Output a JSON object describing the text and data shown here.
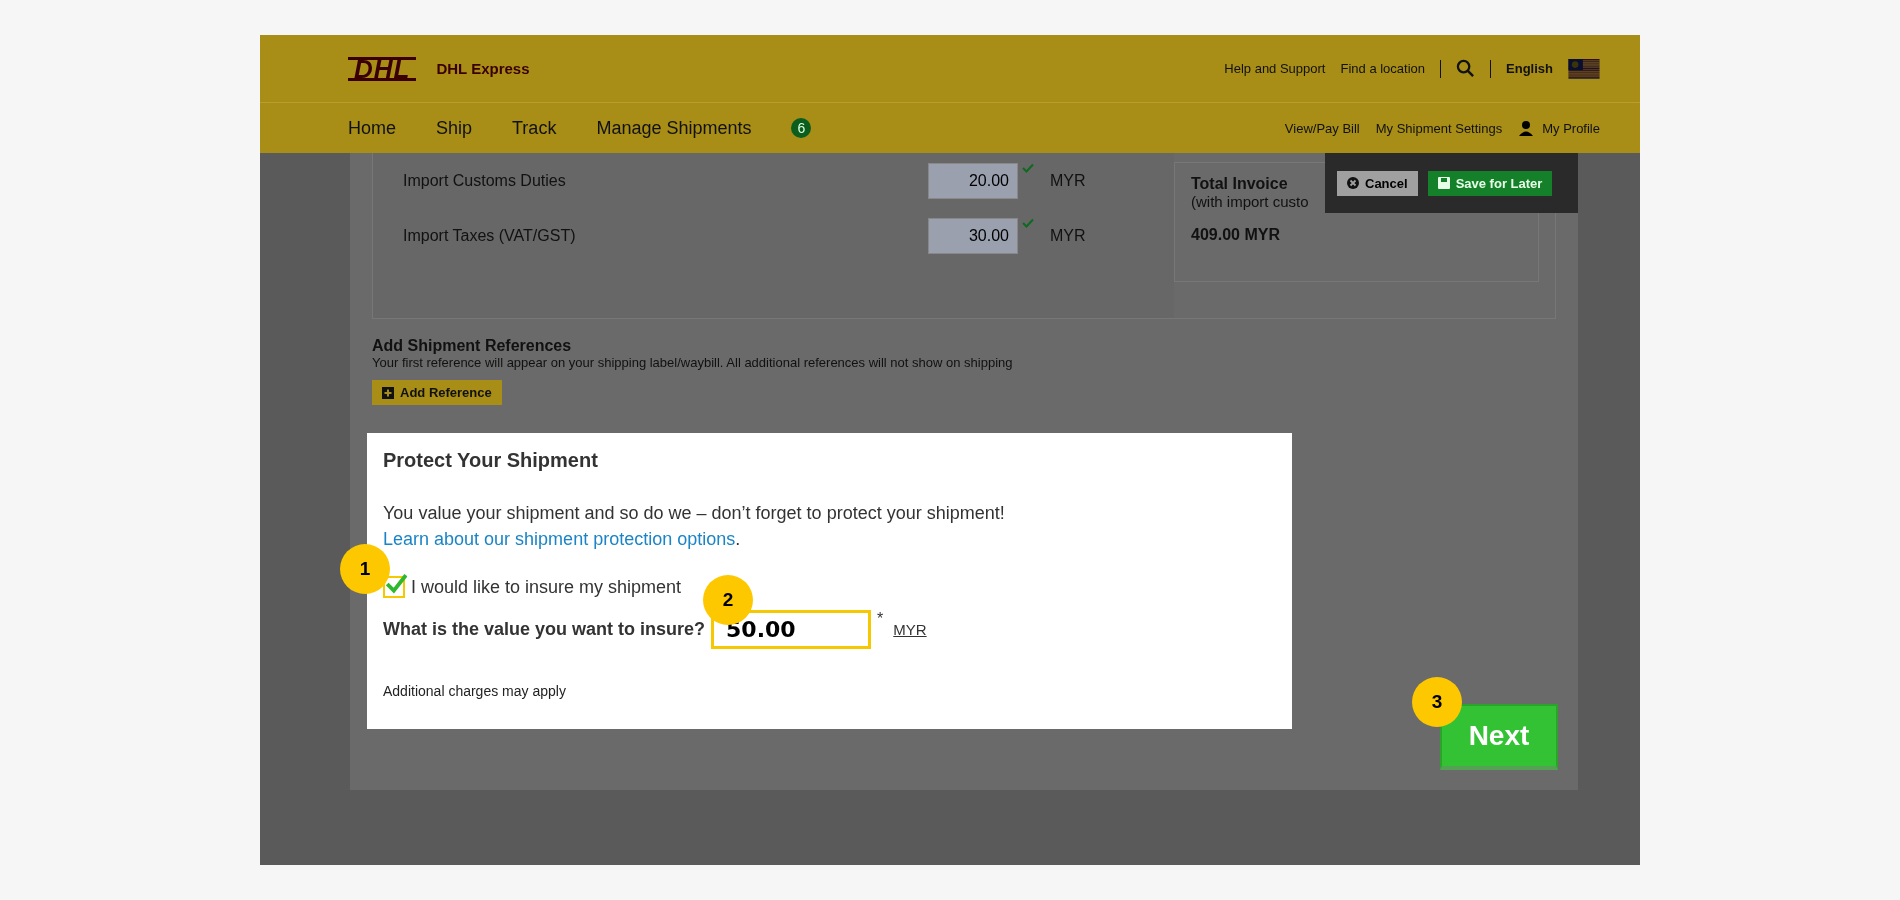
{
  "header": {
    "logo_text": "DHL",
    "brand": "DHL Express",
    "links": [
      "Help and Support",
      "Find a location"
    ],
    "language": "English"
  },
  "nav": {
    "items": [
      {
        "label": "Home"
      },
      {
        "label": "Ship"
      },
      {
        "label": "Track"
      },
      {
        "label": "Manage Shipments",
        "badge": "6"
      }
    ],
    "right_links": [
      "View/Pay Bill",
      "My Shipment Settings"
    ],
    "profile": "My Profile"
  },
  "toolbar": {
    "cancel": "Cancel",
    "save": "Save for Later"
  },
  "charges": [
    {
      "label": "Import Customs Duties",
      "value": "20.00",
      "currency": "MYR"
    },
    {
      "label": "Import Taxes (VAT/GST)",
      "value": "30.00",
      "currency": "MYR"
    }
  ],
  "invoice": {
    "title": "Total Invoice",
    "subtitle": "(with import custo",
    "total": "409.00 MYR"
  },
  "references": {
    "title": "Add Shipment References",
    "description": "Your first reference will appear on your shipping label/waybill. All additional references will not show on shipping",
    "button": "Add Reference"
  },
  "modal": {
    "title": "Protect Your Shipment",
    "text": "You value your shipment and so do we – don’t forget to protect your shipment!",
    "link": "Learn about our shipment protection options",
    "link_suffix": ".",
    "insure": {
      "label": "I would like to insure my shipment",
      "checked": true
    },
    "value_label": "What is the value you want to insure?",
    "value": "50.00",
    "required": "*",
    "currency": "MYR",
    "note": "Additional charges may apply"
  },
  "next_button": "Next",
  "callouts": [
    "1",
    "2",
    "3"
  ]
}
